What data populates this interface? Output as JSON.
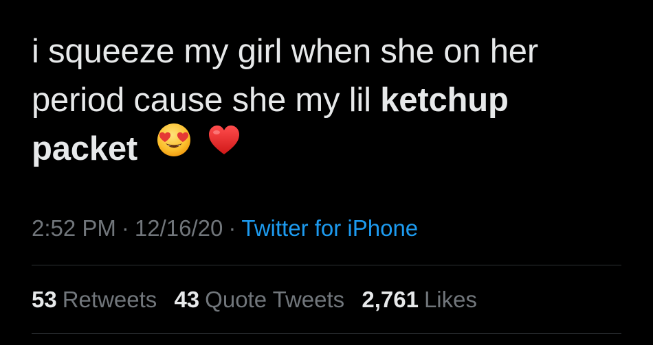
{
  "tweet": {
    "text_line1": "i squeeze my girl when she on her",
    "text_line2_pre": "period cause she my lil ",
    "text_line2_bold": "ketchup",
    "text_line3_bold": "packet",
    "emojis": [
      "heart-eyes-emoji",
      "red-heart-emoji"
    ]
  },
  "meta": {
    "time": "2:52 PM",
    "separator": "·",
    "date": "12/16/20",
    "source": "Twitter for iPhone"
  },
  "stats": {
    "retweets_count": "53",
    "retweets_label": "Retweets",
    "quotes_count": "43",
    "quotes_label": "Quote Tweets",
    "likes_count": "2,761",
    "likes_label": "Likes"
  },
  "colors": {
    "background": "#000000",
    "text": "#e7e9ea",
    "muted": "#71767b",
    "link": "#1d9bf0",
    "divider": "#2f3336"
  }
}
